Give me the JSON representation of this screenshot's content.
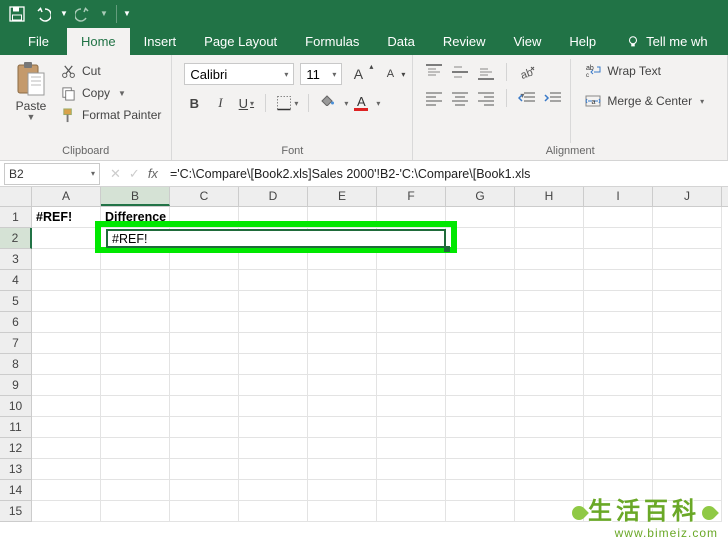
{
  "qat": {
    "save": "save",
    "undo": "undo",
    "redo": "redo"
  },
  "tabs": {
    "file": "File",
    "home": "Home",
    "insert": "Insert",
    "page_layout": "Page Layout",
    "formulas": "Formulas",
    "data": "Data",
    "review": "Review",
    "view": "View",
    "help": "Help",
    "tell_me": "Tell me wh"
  },
  "clipboard": {
    "paste": "Paste",
    "cut": "Cut",
    "copy": "Copy",
    "format_painter": "Format Painter",
    "group": "Clipboard"
  },
  "font": {
    "name": "Calibri",
    "size": "11",
    "bold": "B",
    "italic": "I",
    "underline": "U",
    "inc_a": "A",
    "dec_a": "A",
    "group": "Font",
    "font_color_a": "A",
    "fill_color": "#ffff00",
    "font_color": "#d22"
  },
  "alignment": {
    "wrap": "Wrap Text",
    "merge": "Merge & Center",
    "group": "Alignment"
  },
  "formula_bar": {
    "cell_ref": "B2",
    "cancel": "✕",
    "enter": "✓",
    "fx": "fx",
    "formula": "='C:\\Compare\\[Book2.xls]Sales 2000'!B2-'C:\\Compare\\[Book1.xls"
  },
  "grid": {
    "columns": [
      "A",
      "B",
      "C",
      "D",
      "E",
      "F",
      "G",
      "H",
      "I",
      "J"
    ],
    "rows": [
      1,
      2,
      3,
      4,
      5,
      6,
      7,
      8,
      9,
      10,
      11,
      12,
      13,
      14,
      15
    ],
    "a1": "#REF!",
    "b1": "Difference",
    "b2": "#REF!"
  },
  "watermark": {
    "zh": "生活百科",
    "url": "www.bimeiz.com"
  }
}
